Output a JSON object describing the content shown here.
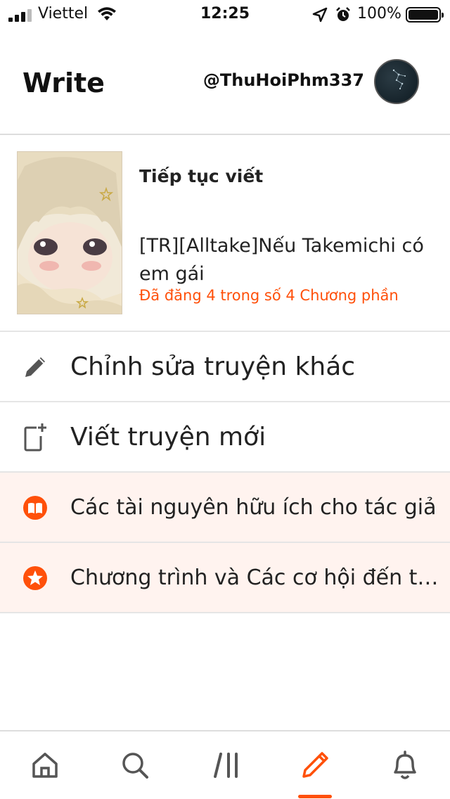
{
  "status_bar": {
    "carrier": "Viettel",
    "time": "12:25",
    "battery": "100%"
  },
  "header": {
    "title": "Write",
    "username": "@ThuHoiPhm337"
  },
  "continue_card": {
    "heading": "Tiếp tục viết",
    "story_title": "[TR][Alltake]Nếu Takemichi có em gái",
    "status": "Đã đăng 4 trong số 4 Chương phần"
  },
  "menu": {
    "edit_other": "Chỉnh sửa truyện khác",
    "new_story": "Viết truyện mới",
    "resources": "Các tài nguyên hữu ích cho tác giả",
    "programs": "Chương trình và Các cơ hội đến từ…"
  },
  "colors": {
    "accent": "#ff500a",
    "tint_row": "#fff3ef"
  },
  "nav": {
    "items": [
      "home-icon",
      "search-icon",
      "library-icon",
      "write-icon",
      "notifications-icon"
    ],
    "active": "write-icon"
  }
}
